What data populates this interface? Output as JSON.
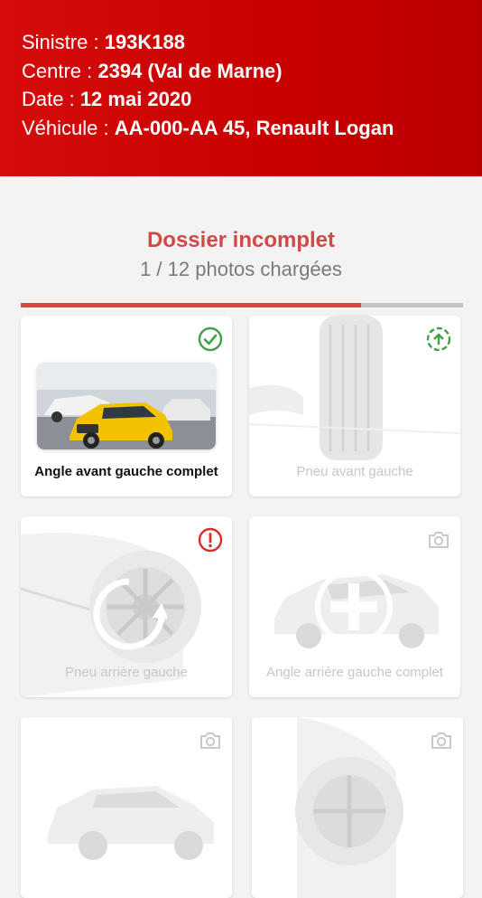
{
  "header": {
    "sinistre_label": "Sinistre : ",
    "sinistre_value": "193K188",
    "centre_label": "Centre : ",
    "centre_value": "2394 (Val de Marne)",
    "date_label": "Date : ",
    "date_value": "12 mai 2020",
    "vehicule_label": "Véhicule : ",
    "vehicule_value": "AA-000-AA 45, Renault Logan"
  },
  "status": {
    "title": "Dossier incomplet",
    "subtitle": "1 / 12 photos chargées",
    "progress_percent": 77
  },
  "photos": [
    {
      "label": "Angle avant gauche complet",
      "state": "validated",
      "icon": "check-circle-icon"
    },
    {
      "label": "Pneu avant gauche",
      "state": "uploading",
      "icon": "upload-circle-icon"
    },
    {
      "label": "Pneu arrière gauche",
      "state": "error",
      "icon": "alert-circle-icon"
    },
    {
      "label": "Angle arrière gauche complet",
      "state": "empty",
      "icon": "camera-icon"
    },
    {
      "label": "",
      "state": "empty",
      "icon": "camera-icon"
    },
    {
      "label": "",
      "state": "empty",
      "icon": "camera-icon"
    }
  ],
  "colors": {
    "header": "#c80000",
    "title": "#cf4a46",
    "progress": "#d9443f",
    "success": "#43a047",
    "error": "#d32f2f"
  }
}
